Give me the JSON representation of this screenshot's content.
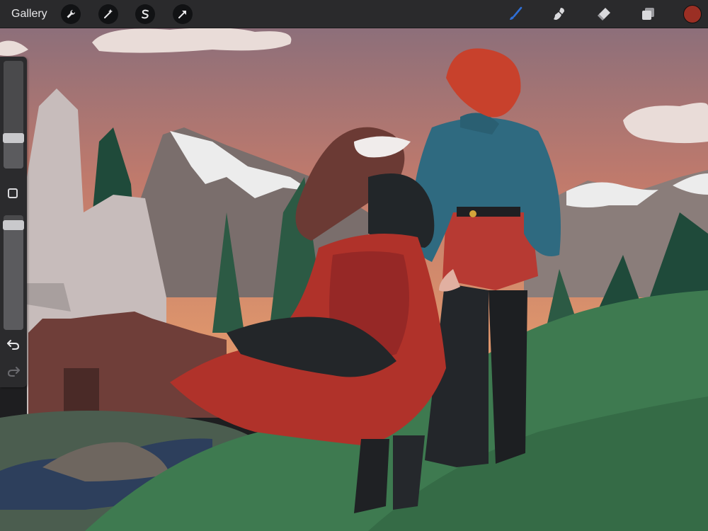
{
  "app": {
    "gallery_label": "Gallery"
  },
  "toolbar": {
    "actions": [
      "wrench-icon",
      "magic-wand-icon",
      "selection-s-icon",
      "transform-arrow-icon"
    ],
    "tools": [
      "brush-icon",
      "smudge-icon",
      "eraser-icon",
      "layers-icon"
    ],
    "active_tool": "brush-icon",
    "brush_color": "#2f6fd6",
    "current_color": "#9b2f24"
  },
  "sidebar": {
    "brush_size_level": 0.26,
    "opacity_level": 0.95,
    "controls": [
      "brush-size-slider",
      "modify-button",
      "opacity-slider",
      "undo-icon",
      "redo-icon"
    ]
  },
  "colors": {
    "sky_top": "#8f707a",
    "sky_bottom": "#d98a66",
    "grass": "#3f7a52",
    "coat": "#2f6a80",
    "dress": "#b0322a",
    "hair_girl": "#6b3a34",
    "hair_boy": "#c8412c"
  }
}
